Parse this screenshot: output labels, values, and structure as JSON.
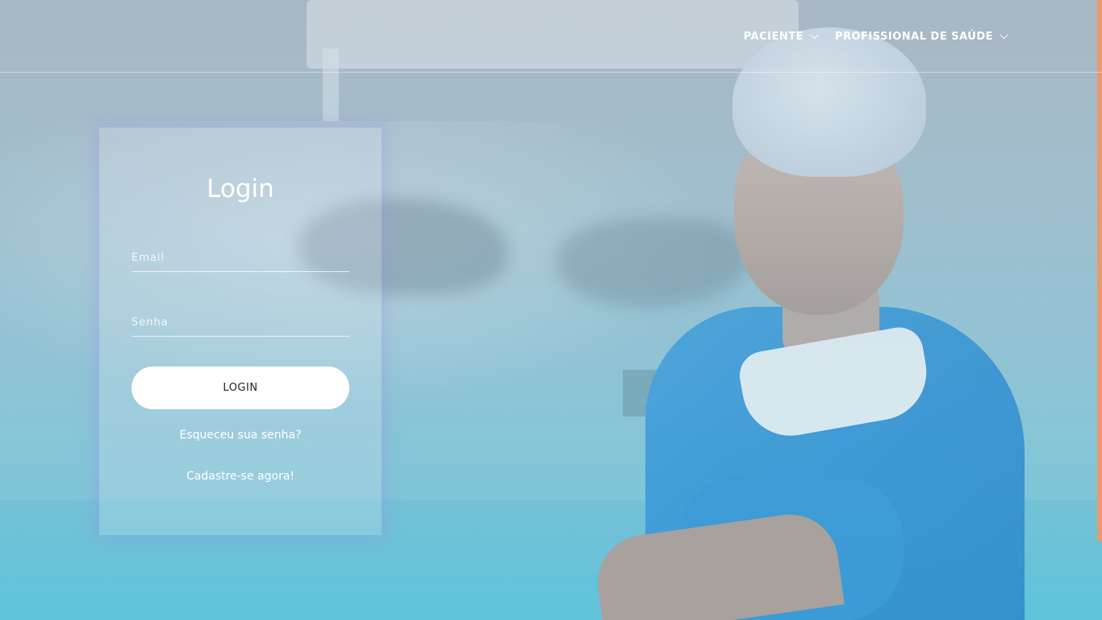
{
  "nav": {
    "items": [
      {
        "label": "PACIENTE",
        "icon": "chevron-down-icon"
      },
      {
        "label": "PROFISSIONAL DE SAÚDE",
        "icon": "chevron-down-icon"
      }
    ]
  },
  "login": {
    "title": "Login",
    "email_placeholder": "Email",
    "email_value": "",
    "password_placeholder": "Senha",
    "password_value": "",
    "button_label": "LOGIN",
    "forgot_link": "Esqueceu sua senha?",
    "signup_link": "Cadastre-se agora!"
  },
  "colors": {
    "accent_right": "#e99a6e",
    "scrubs": "#2c8ed3",
    "button_bg": "#ffffff"
  }
}
